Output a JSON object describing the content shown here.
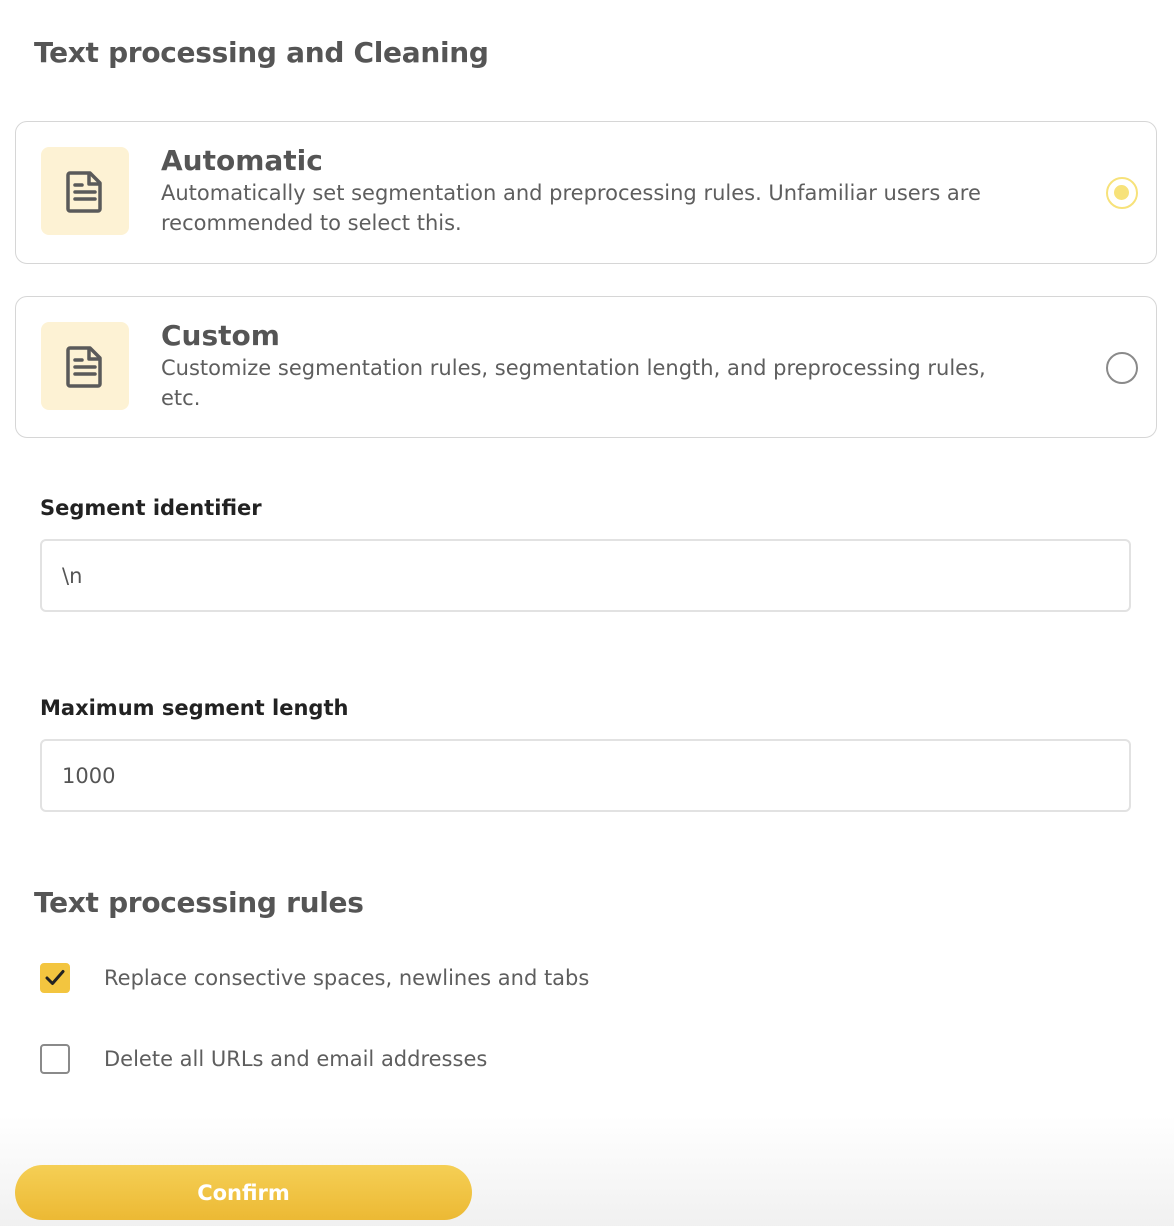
{
  "header": {
    "title": "Text processing and Cleaning"
  },
  "options": [
    {
      "title": "Automatic",
      "description": "Automatically set segmentation and preprocessing rules. Unfamiliar users are recommended to select this.",
      "icon": "document-icon",
      "selected": true
    },
    {
      "title": "Custom",
      "description": "Customize segmentation rules, segmentation length, and preprocessing rules, etc.",
      "icon": "document-icon",
      "selected": false
    }
  ],
  "segment_identifier": {
    "label": "Segment identifier",
    "value": "\\n"
  },
  "max_segment_length": {
    "label": "Maximum segment length",
    "value": "1000"
  },
  "rules": {
    "title": "Text processing rules",
    "items": [
      {
        "label": "Replace consective spaces, newlines and tabs",
        "checked": true
      },
      {
        "label": "Delete all URLs and email addresses",
        "checked": false
      }
    ]
  },
  "actions": {
    "confirm_label": "Confirm"
  },
  "colors": {
    "accent": "#f3c53f",
    "radio_selected": "#f7e27a",
    "icon_bg": "#fdf2d4"
  }
}
